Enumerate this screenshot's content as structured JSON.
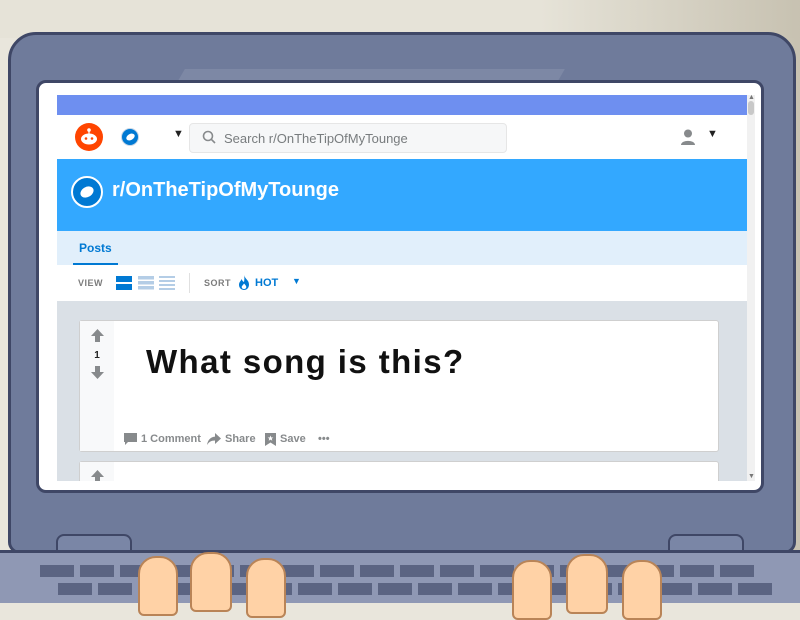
{
  "header": {
    "logo_icon": "reddit-alien-icon",
    "community_icon": "leaf-icon",
    "search_placeholder": "Search r/OnTheTipOfMyTounge",
    "user_icon": "user-icon"
  },
  "subreddit": {
    "name": "r/OnTheTipOfMyTounge"
  },
  "tabs": [
    {
      "label": "Posts"
    }
  ],
  "viewbar": {
    "view_label": "VIEW",
    "sort_label": "SORT",
    "sort_value": "HOT",
    "sort_icon": "flame-icon"
  },
  "posts": [
    {
      "score": "1",
      "title": "What song is this?",
      "actions": {
        "comments": "1 Comment",
        "share": "Share",
        "save": "Save",
        "more": "•••"
      }
    }
  ],
  "colors": {
    "accent": "#6e8ff0",
    "banner": "#33a8ff",
    "tabs_bg": "#e1effb",
    "link": "#0079d3",
    "reddit_orange": "#ff4500"
  }
}
